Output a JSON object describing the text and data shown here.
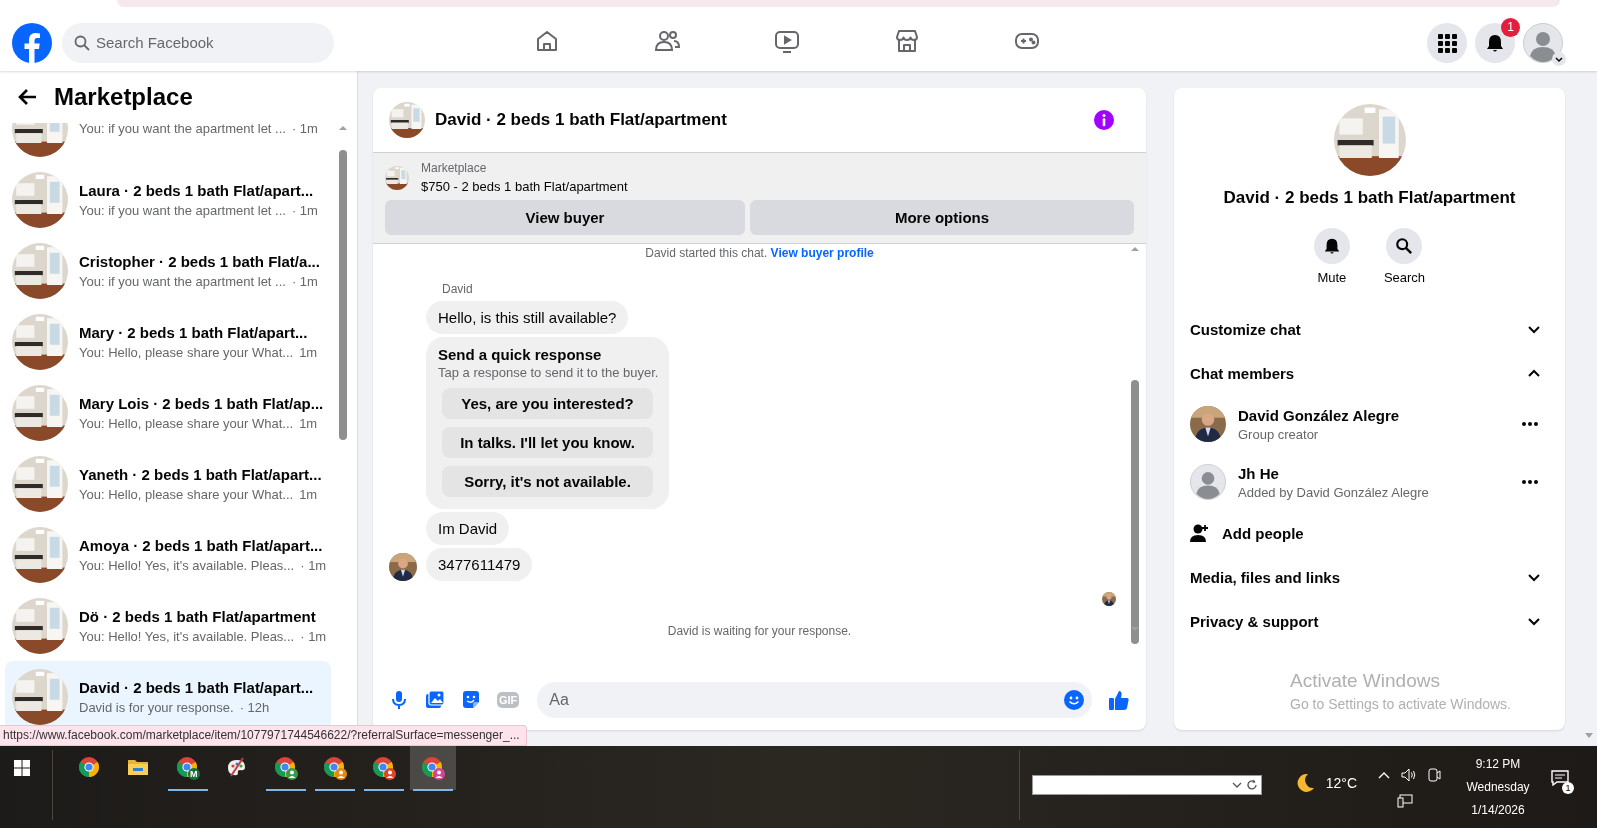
{
  "topbar": {
    "search": {
      "placeholder": "Search Facebook"
    },
    "nav": [
      {
        "kind": "home",
        "selected": false
      },
      {
        "kind": "friends",
        "selected": false
      },
      {
        "kind": "video",
        "selected": false
      },
      {
        "kind": "marketplace",
        "selected": false
      },
      {
        "kind": "gaming",
        "selected": false
      }
    ],
    "notification_count": "1"
  },
  "sidebar": {
    "title": "Marketplace",
    "conversations": [
      {
        "preview": "You: if you want the apartment let ...",
        "time": "· 1m",
        "selected": false
      },
      {
        "name": "Laura · 2 beds 1 bath Flat/apart...",
        "preview": "You: if you want the apartment let ...",
        "time": "· 1m",
        "selected": false
      },
      {
        "name": "Cristopher · 2 beds 1 bath Flat/a...",
        "preview": "You: if you want the apartment let ...",
        "time": "· 1m",
        "selected": false
      },
      {
        "name": "Mary · 2 beds 1 bath Flat/apart...",
        "preview": "You: Hello, please share your What...",
        "time": "1m",
        "selected": false
      },
      {
        "name": "Mary Lois · 2 beds 1 bath Flat/ap...",
        "preview": "You: Hello, please share your What...",
        "time": "1m",
        "selected": false
      },
      {
        "name": "Yaneth · 2 beds 1 bath Flat/apart...",
        "preview": "You: Hello, please share your What...",
        "time": "1m",
        "selected": false
      },
      {
        "name": "Amoya · 2 beds 1 bath Flat/apart...",
        "preview": "You: Hello! Yes, it's available. Pleas...",
        "time": "· 1m",
        "selected": false
      },
      {
        "name": "Dö · 2 beds 1 bath Flat/apartment",
        "preview": "You: Hello! Yes, it's available. Pleas...",
        "time": "· 1m",
        "selected": false
      },
      {
        "name": "David · 2 beds 1 bath Flat/apart...",
        "preview": "David is for your response.",
        "time": "· 12h",
        "selected": true
      }
    ]
  },
  "chat": {
    "title": "David · 2 beds 1 bath Flat/apartment",
    "listing": {
      "source": "Marketplace",
      "title": "$750 - 2 beds 1 bath Flat/apartment",
      "buttons": [
        "View buyer",
        "More options"
      ]
    },
    "intro": {
      "text": "David started this chat.",
      "link": "View buyer profile"
    },
    "messages": [
      {
        "kind": "sender",
        "text": "David"
      },
      {
        "kind": "bubble",
        "text": "Hello, is this still available?",
        "avatar": false
      },
      {
        "kind": "quick_responses",
        "title": "Send a quick response",
        "subtitle": "Tap a response to send it to the buyer.",
        "options": [
          "Yes, are you interested?",
          "In talks. I'll let you know.",
          "Sorry, it's not available."
        ]
      },
      {
        "kind": "bubble",
        "text": "Im David",
        "avatar": false
      },
      {
        "kind": "bubble",
        "text": "3477611479",
        "avatar": true
      }
    ],
    "status": "David is waiting for your response.",
    "composer": {
      "placeholder": "Aa",
      "gif_label": "GIF"
    }
  },
  "details": {
    "title": "David · 2 beds 1 bath Flat/apartment",
    "actions": [
      {
        "kind": "mute",
        "label": "Mute"
      },
      {
        "kind": "search",
        "label": "Search"
      }
    ],
    "rows": [
      {
        "kind": "section",
        "label": "Customize chat",
        "expanded": false
      },
      {
        "kind": "section",
        "label": "Chat members",
        "expanded": true
      },
      {
        "kind": "member",
        "name": "David González Alegre",
        "role": "Group creator",
        "photo": true
      },
      {
        "kind": "member",
        "name": "Jh He",
        "role": "Added by David González Alegre",
        "photo": false
      },
      {
        "kind": "action",
        "label": "Add people"
      },
      {
        "kind": "section",
        "label": "Media, files and links",
        "expanded": false
      },
      {
        "kind": "section",
        "label": "Privacy & support",
        "expanded": false
      }
    ],
    "watermark": {
      "title": "Activate Windows",
      "text": "Go to Settings to activate Windows."
    }
  },
  "url_tooltip": "https://www.facebook.com/marketplace/item/1077971744546622/?referralSurface=messenger_...",
  "taskbar": {
    "apps": [
      {
        "kind": "chrome",
        "running": false,
        "selected": false
      },
      {
        "kind": "folder",
        "running": false,
        "selected": false
      },
      {
        "kind": "chrome",
        "badge": "M",
        "running": true,
        "selected": false
      },
      {
        "kind": "paint",
        "running": false,
        "selected": false
      },
      {
        "kind": "chrome",
        "color": "#3a9a4a",
        "running": true,
        "selected": false
      },
      {
        "kind": "chrome",
        "color": "#e08a1e",
        "running": true,
        "selected": false
      },
      {
        "kind": "chrome",
        "color": "#d9482b",
        "running": true,
        "selected": false
      },
      {
        "kind": "chrome",
        "color": "#d64595",
        "running": true,
        "selected": true
      }
    ],
    "weather": "12°C",
    "time": "9:12 PM",
    "day": "Wednesday",
    "date": "1/14/2026",
    "notification_count": "1"
  }
}
